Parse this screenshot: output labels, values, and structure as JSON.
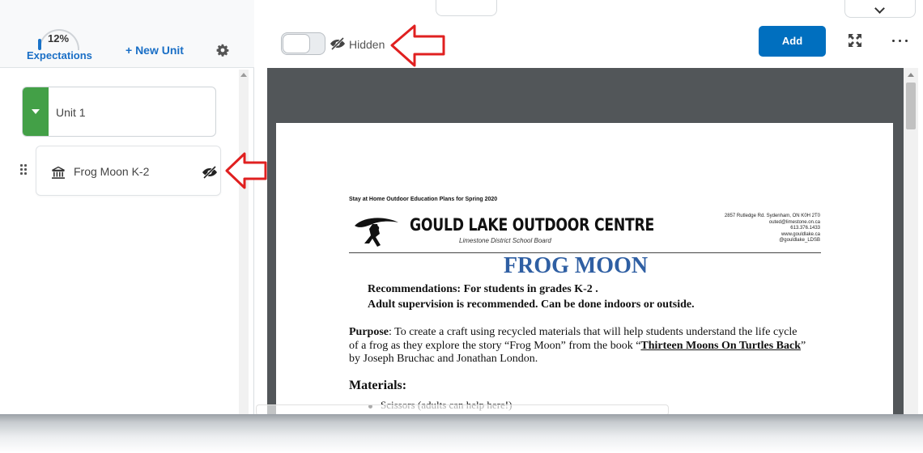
{
  "left_header": {
    "expectations_percent": "12%",
    "expectations_label": "Expectations",
    "expectations_progress": 0.12,
    "new_unit_label": "+ New Unit",
    "settings_icon": "gear-icon"
  },
  "units": [
    {
      "label": "Unit 1",
      "expanded": true
    }
  ],
  "lessons": [
    {
      "label": "Frog Moon K-2",
      "icon": "building-icon",
      "status_icon": "eye-slash-icon"
    }
  ],
  "toolbar": {
    "visibility_label": "Hidden",
    "visibility_on": false,
    "add_label": "Add",
    "expand_icon": "fullscreen-icon",
    "more_icon": "more-horizontal-icon"
  },
  "document": {
    "heading": "Stay at Home Outdoor Education Plans for Spring 2020",
    "org_name": "GOULD LAKE OUTDOOR CENTRE",
    "board": "Limestone District School Board",
    "contact": [
      "2857 Rutledge Rd. Sydenham, ON K0H 2T0",
      "outed@limestone.on.ca",
      "613.376.1433",
      "www.gouldlake.ca",
      "@gouldlake_LDSB"
    ],
    "title": "FROG MOON",
    "rec_line1": "Recommendations:  For students in grades K-2 .",
    "rec_line2": "Adult supervision is recommended.  Can be done indoors or outside.",
    "purpose_label": "Purpose",
    "purpose_text1": ": To create a craft using recycled materials that will help students understand the life cycle of a frog as they explore the story “Frog Moon” from the book “",
    "purpose_book": "Thirteen Moons On Turtles Back",
    "purpose_text2": "” by Joseph Bruchac and Jonathan London.",
    "materials_label": "Materials:",
    "materials": [
      "Scissors (adults can help here!)"
    ]
  },
  "colors": {
    "accent_blue": "#006fbf",
    "unit_green": "#43a047",
    "doc_title_blue": "#2f5fa3",
    "annotation_red": "#e02020"
  }
}
